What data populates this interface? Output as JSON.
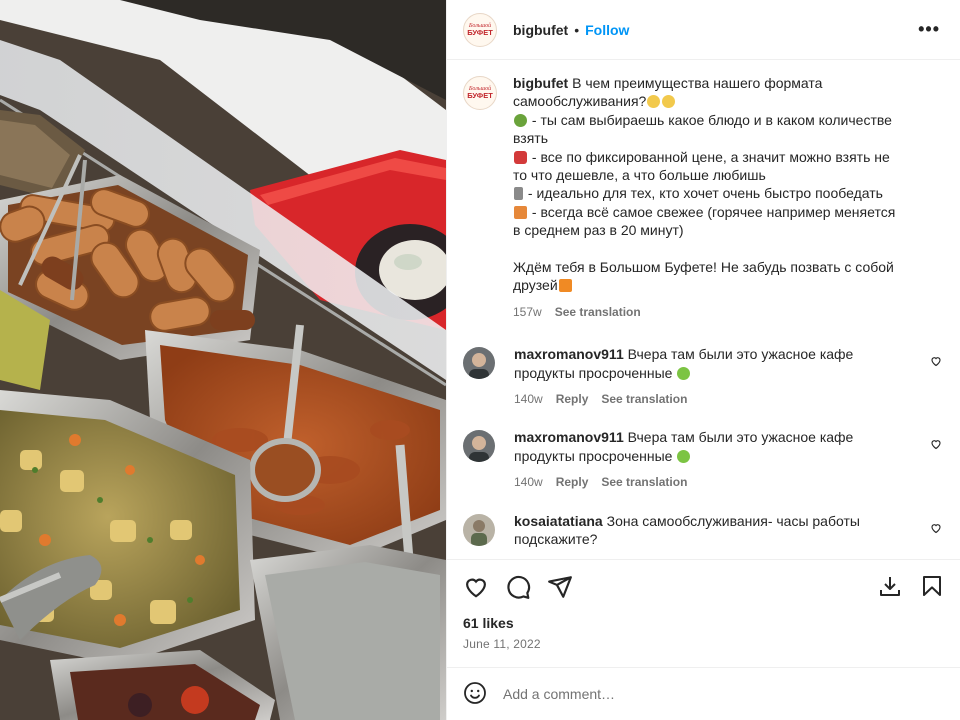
{
  "post": {
    "username": "bigbufet",
    "follow_label": "Follow",
    "separator": "•",
    "more_label": "•••",
    "avatar_brand_line1": "Большой",
    "avatar_brand_line2": "БУФЕТ",
    "caption": {
      "username": "bigbufet",
      "line1": " В чем преимущества нашего формата",
      "line2": "самообслуживания?",
      "line3": " - ты сам выбираешь какое блюдо и в каком количестве",
      "line4": "взять",
      "line5": " - все по фиксированной цене, а значит можно взять не",
      "line6": "то что дешевле, а что больше любишь",
      "line7": " - идеально для тех, кто хочет очень быстро пообедать",
      "line8": " - всегда всё самое свежее (горячее например меняется",
      "line9": "в среднем раз в 20 минут)",
      "line10": "Ждём тебя в Большом Буфете! Не забудь позвать с собой",
      "line11": "друзей",
      "age": "157w",
      "see_translation": "See translation"
    },
    "comments": [
      {
        "username": "maxromanov911",
        "text1": " Вчера там были это ужасное кафе",
        "text2": "продукты просроченные",
        "age": "140w",
        "reply": "Reply",
        "see_translation": "See translation"
      },
      {
        "username": "maxromanov911",
        "text1": " Вчера там были это ужасное кафе",
        "text2": "продукты просроченные",
        "age": "140w",
        "reply": "Reply",
        "see_translation": "See translation"
      },
      {
        "username": "kosaiatatiana",
        "text1": " Зона самообслуживания- часы работы",
        "text2": "подскажите?"
      }
    ],
    "likes": "61 likes",
    "date": "June 11, 2022",
    "add_comment_placeholder": "Add a comment…",
    "icons": {
      "like": "heart-icon",
      "comment": "comment-icon",
      "share": "share-icon",
      "download": "download-icon",
      "save": "bookmark-icon",
      "emoji": "emoji-icon"
    }
  },
  "colors": {
    "follow": "#0095f6",
    "text": "#262626",
    "secondary": "#737373",
    "border": "#efefef"
  }
}
